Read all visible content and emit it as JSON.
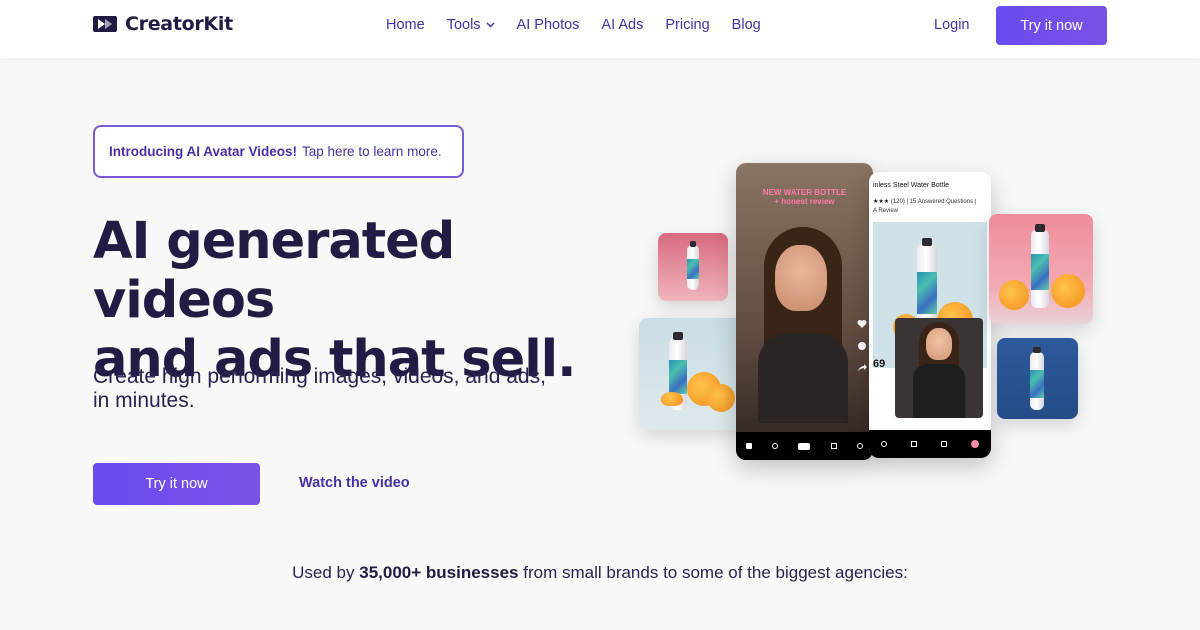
{
  "nav": {
    "brand": "CreatorKit",
    "items": [
      {
        "label": "Home"
      },
      {
        "label": "Tools"
      },
      {
        "label": "AI Photos"
      },
      {
        "label": "AI Ads"
      },
      {
        "label": "Pricing"
      },
      {
        "label": "Blog"
      }
    ],
    "login": "Login",
    "cta": "Try it now"
  },
  "hero": {
    "pill_strong": "Introducing AI Avatar Videos!",
    "pill_text": "Tap here to learn more.",
    "headline_line1": "AI generated videos",
    "headline_line2": "and ads that sell.",
    "subtitle_line1": "Create high performing images, videos, and ads,",
    "subtitle_line2": "in minutes.",
    "cta_primary": "Try it now",
    "cta_secondary": "Watch the video"
  },
  "collage": {
    "overlay_line1": "NEW WATER BOTTLE",
    "overlay_line2": "+ honest review",
    "product_title": "inless Steel Water Bottle",
    "rating_text": "(120) | 15 Answered Questions |",
    "review_text": "A Review",
    "price": "69",
    "colors": {
      "accent": "#6a4bf0",
      "pink": "#f2a0a8",
      "blue": "#2f5d9f",
      "teal": "#c8dde3"
    }
  },
  "social_proof": {
    "prefix": "Used by",
    "highlight": "35,000+ businesses",
    "suffix": "from small brands to some of the biggest agencies:"
  }
}
